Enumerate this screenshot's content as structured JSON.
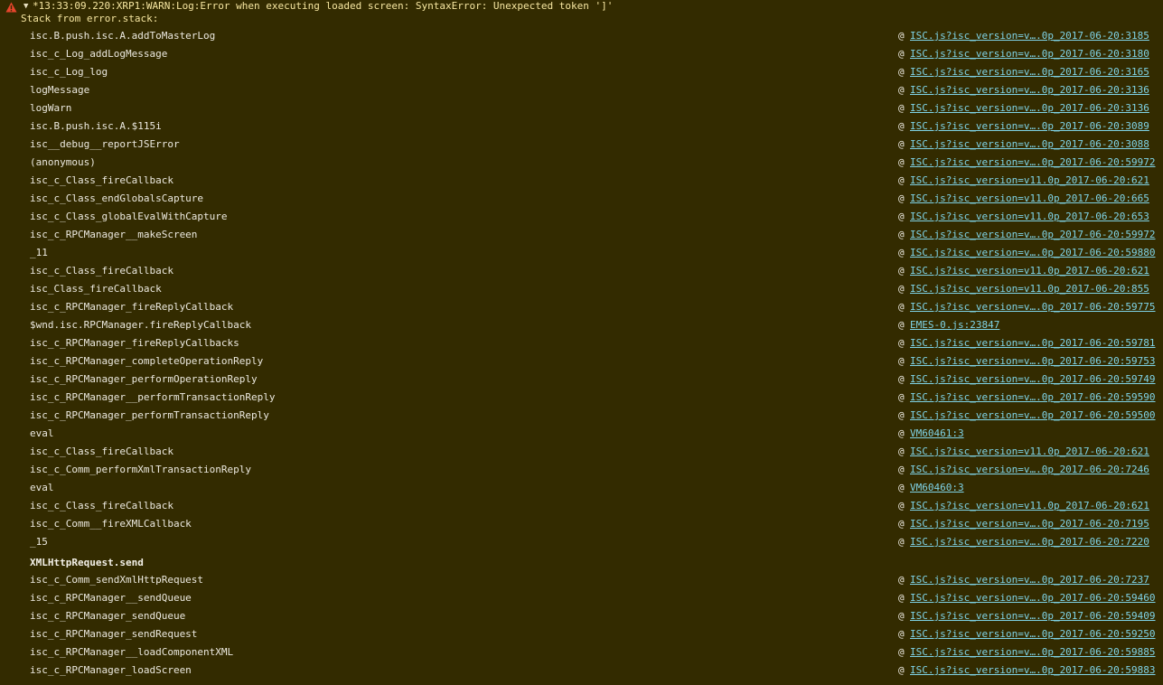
{
  "header": {
    "message": "*13:33:09.220:XRP1:WARN:Log:Error when executing loaded screen: SyntaxError: Unexpected token ']'",
    "caret": "▼",
    "subtitle": "Stack from error.stack:"
  },
  "colors": {
    "background": "#332b00",
    "warning_text": "#f6e6a0",
    "link": "#7fd3e6",
    "warning_icon": "#e8452c"
  },
  "icons": {
    "warning": "warning-triangle-icon",
    "expand": "caret-down-icon"
  },
  "at_symbol": "@",
  "frames": [
    {
      "fn": "isc.B.push.isc.A.addToMasterLog",
      "loc": "ISC.js?isc_version=v….0p_2017-06-20:3185"
    },
    {
      "fn": "isc_c_Log_addLogMessage",
      "loc": "ISC.js?isc_version=v….0p_2017-06-20:3180"
    },
    {
      "fn": "isc_c_Log_log",
      "loc": "ISC.js?isc_version=v….0p_2017-06-20:3165"
    },
    {
      "fn": "logMessage",
      "loc": "ISC.js?isc_version=v….0p_2017-06-20:3136"
    },
    {
      "fn": "logWarn",
      "loc": "ISC.js?isc_version=v….0p_2017-06-20:3136"
    },
    {
      "fn": "isc.B.push.isc.A.$115i",
      "loc": "ISC.js?isc_version=v….0p_2017-06-20:3089"
    },
    {
      "fn": "isc__debug__reportJSError",
      "loc": "ISC.js?isc_version=v….0p_2017-06-20:3088"
    },
    {
      "fn": "(anonymous)",
      "loc": "ISC.js?isc_version=v….0p_2017-06-20:59972"
    },
    {
      "fn": "isc_c_Class_fireCallback",
      "loc": "ISC.js?isc_version=v11.0p_2017-06-20:621"
    },
    {
      "fn": "isc_c_Class_endGlobalsCapture",
      "loc": "ISC.js?isc_version=v11.0p_2017-06-20:665"
    },
    {
      "fn": "isc_c_Class_globalEvalWithCapture",
      "loc": "ISC.js?isc_version=v11.0p_2017-06-20:653"
    },
    {
      "fn": "isc_c_RPCManager__makeScreen",
      "loc": "ISC.js?isc_version=v….0p_2017-06-20:59972"
    },
    {
      "fn": "_11",
      "loc": "ISC.js?isc_version=v….0p_2017-06-20:59880"
    },
    {
      "fn": "isc_c_Class_fireCallback",
      "loc": "ISC.js?isc_version=v11.0p_2017-06-20:621"
    },
    {
      "fn": "isc_Class_fireCallback",
      "loc": "ISC.js?isc_version=v11.0p_2017-06-20:855"
    },
    {
      "fn": "isc_c_RPCManager_fireReplyCallback",
      "loc": "ISC.js?isc_version=v….0p_2017-06-20:59775"
    },
    {
      "fn": "$wnd.isc.RPCManager.fireReplyCallback",
      "loc": "EMES-0.js:23847"
    },
    {
      "fn": "isc_c_RPCManager_fireReplyCallbacks",
      "loc": "ISC.js?isc_version=v….0p_2017-06-20:59781"
    },
    {
      "fn": "isc_c_RPCManager_completeOperationReply",
      "loc": "ISC.js?isc_version=v….0p_2017-06-20:59753"
    },
    {
      "fn": "isc_c_RPCManager_performOperationReply",
      "loc": "ISC.js?isc_version=v….0p_2017-06-20:59749"
    },
    {
      "fn": "isc_c_RPCManager__performTransactionReply",
      "loc": "ISC.js?isc_version=v….0p_2017-06-20:59590"
    },
    {
      "fn": "isc_c_RPCManager_performTransactionReply",
      "loc": "ISC.js?isc_version=v….0p_2017-06-20:59500"
    },
    {
      "fn": "eval",
      "loc": "VM60461:3"
    },
    {
      "fn": "isc_c_Class_fireCallback",
      "loc": "ISC.js?isc_version=v11.0p_2017-06-20:621"
    },
    {
      "fn": "isc_c_Comm_performXmlTransactionReply",
      "loc": "ISC.js?isc_version=v….0p_2017-06-20:7246"
    },
    {
      "fn": "eval",
      "loc": "VM60460:3"
    },
    {
      "fn": "isc_c_Class_fireCallback",
      "loc": "ISC.js?isc_version=v11.0p_2017-06-20:621"
    },
    {
      "fn": "isc_c_Comm__fireXMLCallback",
      "loc": "ISC.js?isc_version=v….0p_2017-06-20:7195"
    },
    {
      "fn": "_15",
      "loc": "ISC.js?isc_version=v….0p_2017-06-20:7220"
    },
    {
      "fn": "XMLHttpRequest.send",
      "loc": "",
      "async": true
    },
    {
      "fn": "isc_c_Comm_sendXmlHttpRequest",
      "loc": "ISC.js?isc_version=v….0p_2017-06-20:7237"
    },
    {
      "fn": "isc_c_RPCManager__sendQueue",
      "loc": "ISC.js?isc_version=v….0p_2017-06-20:59460"
    },
    {
      "fn": "isc_c_RPCManager_sendQueue",
      "loc": "ISC.js?isc_version=v….0p_2017-06-20:59409"
    },
    {
      "fn": "isc_c_RPCManager_sendRequest",
      "loc": "ISC.js?isc_version=v….0p_2017-06-20:59250"
    },
    {
      "fn": "isc_c_RPCManager__loadComponentXML",
      "loc": "ISC.js?isc_version=v….0p_2017-06-20:59885"
    },
    {
      "fn": "isc_c_RPCManager_loadScreen",
      "loc": "ISC.js?isc_version=v….0p_2017-06-20:59883"
    }
  ]
}
